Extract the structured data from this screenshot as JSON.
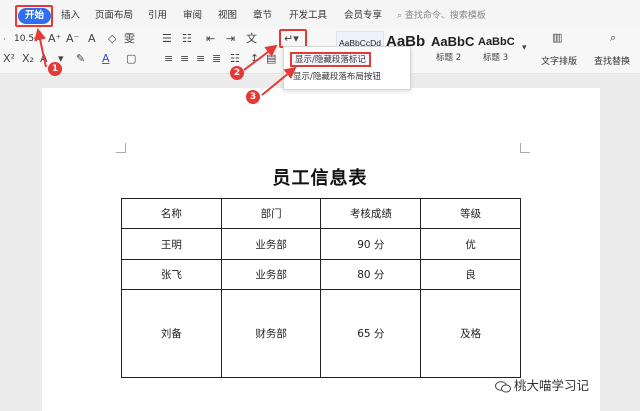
{
  "tabs": [
    {
      "label": "开始",
      "active": true
    },
    {
      "label": "插入"
    },
    {
      "label": "页面布局"
    },
    {
      "label": "引用"
    },
    {
      "label": "审阅"
    },
    {
      "label": "视图"
    },
    {
      "label": "章节"
    },
    {
      "label": "开发工具"
    },
    {
      "label": "会员专享"
    }
  ],
  "search": {
    "placeholder": "查找命令、搜索模板"
  },
  "ribbon": {
    "font_size": "10.5",
    "styles": [
      {
        "preview": "AaBbCcDd",
        "caption": ""
      },
      {
        "preview": "AaBb",
        "caption": "标题 1"
      },
      {
        "preview": "AaBbC",
        "caption": "标题 2"
      },
      {
        "preview": "AaBbC",
        "caption": "标题 3"
      }
    ],
    "text_layout_label": "文字排版",
    "find_replace_label": "查找替换"
  },
  "dropdown": {
    "items": [
      {
        "label": "显示/隐藏段落标记",
        "highlighted": true
      },
      {
        "label": "显示/隐藏段落布局按钮",
        "highlighted": false
      }
    ]
  },
  "callouts": [
    "1",
    "2",
    "3"
  ],
  "document": {
    "title": "员工信息表",
    "table": {
      "headers": [
        "名称",
        "部门",
        "考核成绩",
        "等级"
      ],
      "rows": [
        [
          "王明",
          "业务部",
          "90 分",
          "优"
        ],
        [
          "张飞",
          "业务部",
          "80 分",
          "良"
        ],
        [
          "刘备",
          "财务部",
          "65 分",
          "及格"
        ]
      ]
    }
  },
  "watermark": "桃大喵学习记",
  "colors": {
    "accent": "#2f6fef",
    "highlight": "#e53935"
  }
}
